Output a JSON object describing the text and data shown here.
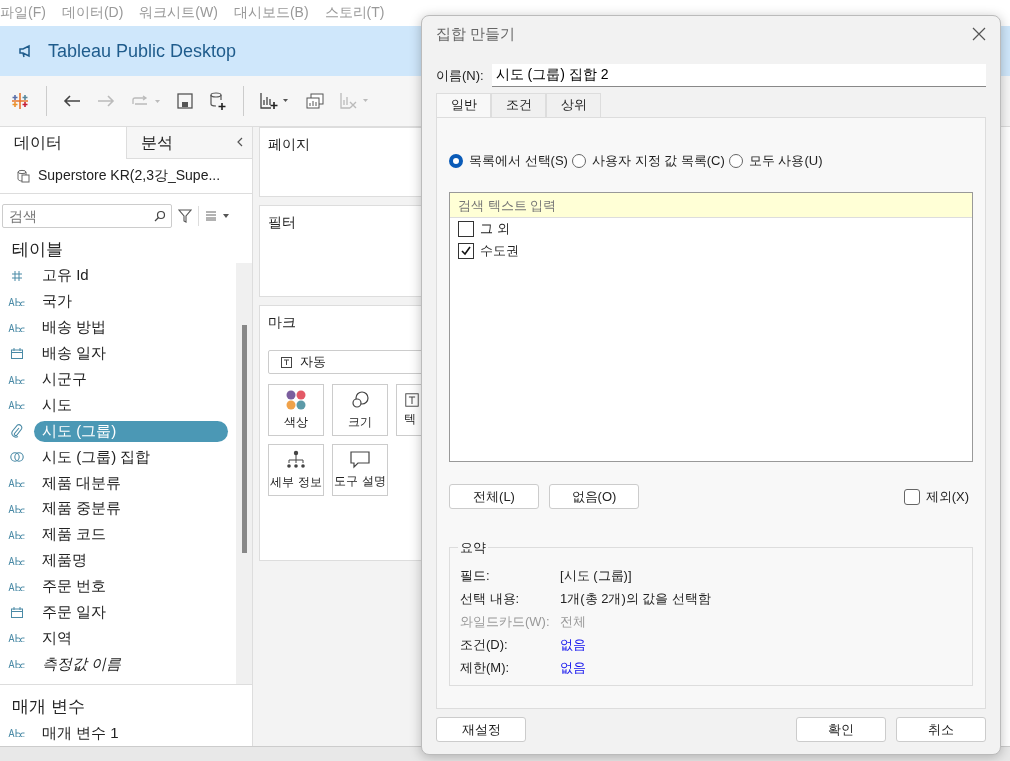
{
  "menu": [
    "파일(F)",
    "데이터(D)",
    "워크시트(W)",
    "대시보드(B)",
    "스토리(T)"
  ],
  "banner": {
    "title": "Tableau Public Desktop"
  },
  "side_tabs": [
    {
      "label": "데이터",
      "selected": true
    },
    {
      "label": "분석",
      "selected": false
    }
  ],
  "datasource": "Superstore KR(2,3강_Supe...",
  "search": {
    "placeholder": "검색"
  },
  "tables_heading": "테이블",
  "fields": [
    {
      "kind": "number",
      "name": "고유 Id",
      "selected": false,
      "italic": false
    },
    {
      "kind": "string",
      "name": "국가",
      "selected": false,
      "italic": false
    },
    {
      "kind": "string",
      "name": "배송 방법",
      "selected": false,
      "italic": false
    },
    {
      "kind": "date",
      "name": "배송 일자",
      "selected": false,
      "italic": false
    },
    {
      "kind": "string",
      "name": "시군구",
      "selected": false,
      "italic": false
    },
    {
      "kind": "string",
      "name": "시도",
      "selected": false,
      "italic": false
    },
    {
      "kind": "group",
      "name": "시도 (그룹)",
      "selected": true,
      "italic": false
    },
    {
      "kind": "set",
      "name": "시도 (그룹) 집합",
      "selected": false,
      "italic": false
    },
    {
      "kind": "string",
      "name": "제품 대분류",
      "selected": false,
      "italic": false
    },
    {
      "kind": "string",
      "name": "제품 중분류",
      "selected": false,
      "italic": false
    },
    {
      "kind": "string",
      "name": "제품 코드",
      "selected": false,
      "italic": false
    },
    {
      "kind": "string",
      "name": "제품명",
      "selected": false,
      "italic": false
    },
    {
      "kind": "string",
      "name": "주문 번호",
      "selected": false,
      "italic": false
    },
    {
      "kind": "date",
      "name": "주문 일자",
      "selected": false,
      "italic": false
    },
    {
      "kind": "string",
      "name": "지역",
      "selected": false,
      "italic": false
    },
    {
      "kind": "string",
      "name": "측정값 이름",
      "selected": false,
      "italic": true
    }
  ],
  "params_heading": "매개 변수",
  "params": [
    {
      "kind": "string",
      "name": "매개 변수 1"
    }
  ],
  "shelves": {
    "pages": "페이지",
    "filters": "필터",
    "marks": "마크",
    "mark_type": "자동",
    "mark_cards": [
      {
        "kind": "color",
        "label": "색상"
      },
      {
        "kind": "size",
        "label": "크기"
      },
      {
        "kind": "text",
        "label": "텍"
      },
      {
        "kind": "detail",
        "label": "세부 정보"
      },
      {
        "kind": "tooltip",
        "label": "도구 설명"
      }
    ]
  },
  "dialog": {
    "title": "집합 만들기",
    "name_label": "이름(N):",
    "name_value": "시도 (그룹) 집합 2",
    "tabs": [
      {
        "label": "일반",
        "selected": true
      },
      {
        "label": "조건",
        "selected": false
      },
      {
        "label": "상위",
        "selected": false
      }
    ],
    "radios": [
      {
        "label": "목록에서 선택(S)",
        "selected": true
      },
      {
        "label": "사용자 지정 값 목록(C)",
        "selected": false
      },
      {
        "label": "모두 사용(U)",
        "selected": false
      }
    ],
    "list_search": {
      "placeholder": "검색 텍스트 입력"
    },
    "items": [
      {
        "label": "그 외",
        "checked": false
      },
      {
        "label": "수도권",
        "checked": true
      }
    ],
    "all_button": "전체(L)",
    "none_button": "없음(O)",
    "exclude": {
      "label": "제외(X)",
      "checked": false
    },
    "summary_title": "요약",
    "summary": [
      {
        "label": "필드:",
        "value": "[시도 (그룹)]",
        "kind": "normal"
      },
      {
        "label": "선택 내용:",
        "value": "1개(총 2개)의 값을 선택함",
        "kind": "normal"
      },
      {
        "label": "와일드카드(W):",
        "value": "전체",
        "kind": "disabled"
      },
      {
        "label": "조건(D):",
        "value": "없음",
        "kind": "link"
      },
      {
        "label": "제한(M):",
        "value": "없음",
        "kind": "link"
      }
    ],
    "reset_button": "재설정",
    "ok_button": "확인",
    "cancel_button": "취소"
  }
}
